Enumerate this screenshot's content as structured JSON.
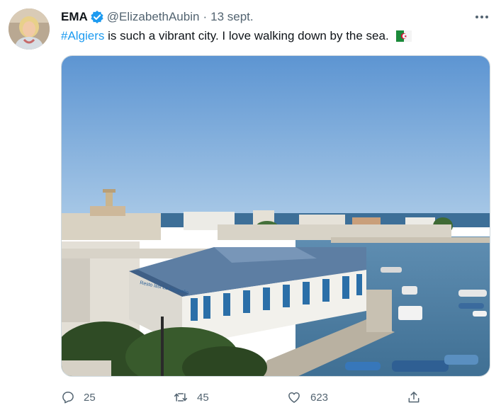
{
  "tweet": {
    "author_name": "EMA",
    "handle": "@ElizabethAubin",
    "separator": "·",
    "timestamp": "13 sept.",
    "hashtag": "#Algiers",
    "text": " is such a vibrant city.  I love walking down by the sea.",
    "flag_icon": "algeria-flag-icon",
    "image_sign_text": "Resto lasi Le Roupelin"
  },
  "actions": {
    "reply_count": "25",
    "retweet_count": "45",
    "like_count": "623"
  },
  "colors": {
    "accent": "#1d9bf0",
    "secondary_text": "#536471",
    "sky": "#74a6d9",
    "sea": "#4f7fa3"
  },
  "icons": [
    "verified-badge-icon",
    "more-icon",
    "reply-icon",
    "retweet-icon",
    "like-icon",
    "share-icon"
  ]
}
